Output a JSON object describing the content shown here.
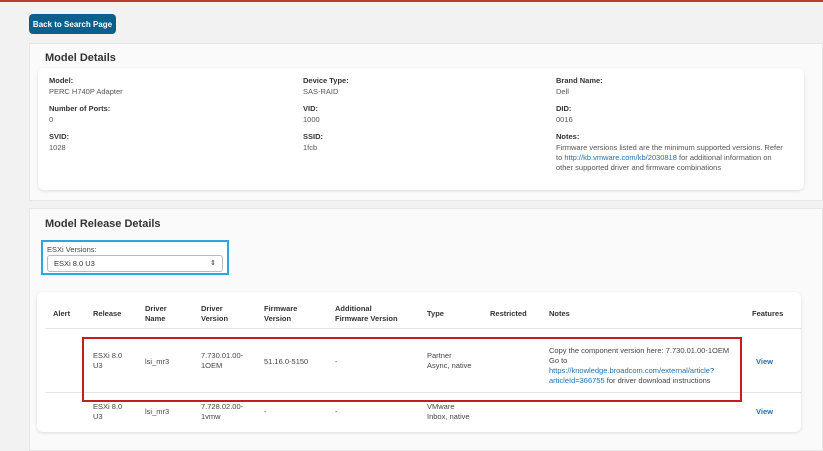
{
  "header": {
    "back_label": "Back to Search Page"
  },
  "model_details": {
    "title": "Model Details",
    "fields": {
      "model": {
        "label": "Model:",
        "value": "PERC H740P Adapter"
      },
      "ports": {
        "label": "Number of Ports:",
        "value": "0"
      },
      "svid": {
        "label": "SVID:",
        "value": "1028"
      },
      "device_type": {
        "label": "Device Type:",
        "value": "SAS-RAID"
      },
      "vid": {
        "label": "VID:",
        "value": "1000"
      },
      "ssid": {
        "label": "SSID:",
        "value": "1fcb"
      },
      "brand": {
        "label": "Brand Name:",
        "value": "Dell"
      },
      "did": {
        "label": "DID:",
        "value": "0016"
      },
      "notes": {
        "label": "Notes:",
        "line1": "Firmware versions listed are the minimum supported versions. Refer",
        "line2_prefix": "to ",
        "link": "http://kb.vmware.com/kb/2030818",
        "line2_suffix": " for additional information on",
        "line3": "other supported driver and firmware combinations"
      }
    }
  },
  "release_details": {
    "title": "Model Release Details",
    "esxi": {
      "label": "ESXi Versions:",
      "selected": "ESXi 8.0 U3",
      "arrow": "⇕"
    },
    "columns": {
      "alert": "Alert",
      "release": "Release",
      "driver_name": [
        "Driver",
        "Name"
      ],
      "driver_version": [
        "Driver",
        "Version"
      ],
      "firmware_version": [
        "Firmware",
        "Version"
      ],
      "additional_fw": [
        "Additional",
        "Firmware Version"
      ],
      "type": "Type",
      "restricted": "Restricted",
      "notes": "Notes",
      "features": "Features"
    },
    "rows": [
      {
        "release": [
          "ESXi 8.0",
          "U3"
        ],
        "driver_name": "lsi_mr3",
        "driver_version": [
          "7.730.01.00-",
          "1OEM"
        ],
        "firmware_version": "51.16.0-5150",
        "additional_fw": "-",
        "type": [
          "Partner",
          "Async, native"
        ],
        "notes": {
          "line1": "Copy the component version here: 7.730.01.00-1OEM",
          "line2": "Go to",
          "link1": "https://knowledge.broadcom.com/external/article?",
          "link2": "articleId=366755",
          "suffix": " for driver download instructions"
        },
        "feature_link": "View"
      },
      {
        "release": [
          "ESXi 8.0",
          "U3"
        ],
        "driver_name": "lsi_mr3",
        "driver_version": [
          "7.728.02.00-",
          "1vmw"
        ],
        "firmware_version": "-",
        "additional_fw": "-",
        "type": [
          "VMware",
          "Inbox, native"
        ],
        "feature_link": "View"
      }
    ]
  }
}
